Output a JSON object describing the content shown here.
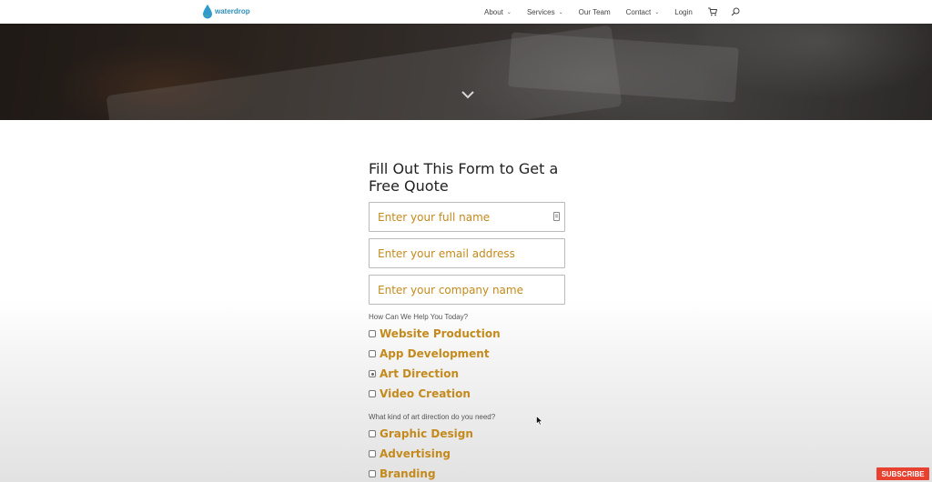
{
  "header": {
    "logo_text": "waterdrop",
    "nav": [
      {
        "label": "About",
        "has_dropdown": true
      },
      {
        "label": "Services",
        "has_dropdown": true
      },
      {
        "label": "Our Team",
        "has_dropdown": false
      },
      {
        "label": "Contact",
        "has_dropdown": true
      },
      {
        "label": "Login",
        "has_dropdown": false
      }
    ],
    "icons": [
      "cart-icon",
      "search-icon"
    ],
    "dropdown_glyph": "⌄"
  },
  "hero": {
    "icons": [
      "chevron-down-icon"
    ]
  },
  "form": {
    "title": "Fill Out This Form to Get a Free Quote",
    "fields": {
      "name_placeholder": "Enter your full name",
      "email_placeholder": "Enter your email address",
      "company_placeholder": "Enter your company name"
    },
    "question1": "How Can We Help You Today?",
    "options1": [
      {
        "label": "Website Production",
        "checked": false
      },
      {
        "label": "App Development",
        "checked": false
      },
      {
        "label": "Art Direction",
        "checked": true
      },
      {
        "label": "Video Creation",
        "checked": false
      }
    ],
    "question2": "What kind of art direction do you need?",
    "options2": [
      {
        "label": "Graphic Design",
        "checked": false
      },
      {
        "label": "Advertising",
        "checked": false
      },
      {
        "label": "Branding",
        "checked": false
      }
    ]
  },
  "overlay": {
    "subscribe_label": "SUBSCRIBE"
  },
  "colors": {
    "accent": "#c48a1c",
    "text_dark": "#222222",
    "subscribe_red": "#e8412f"
  }
}
